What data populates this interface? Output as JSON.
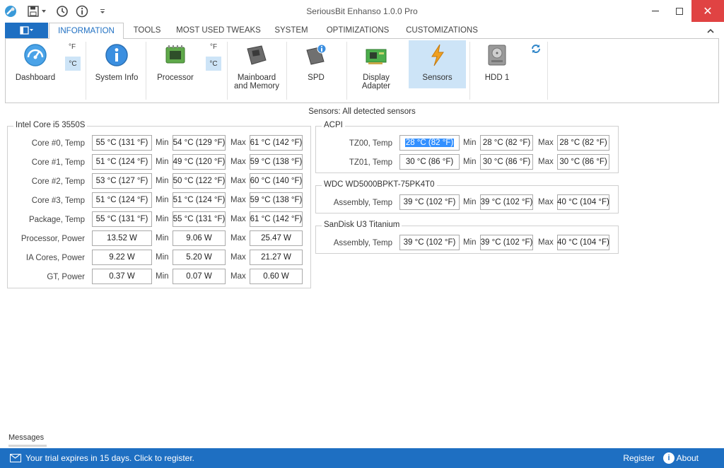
{
  "window": {
    "title": "SeriousBit Enhanso 1.0.0 Pro",
    "close_glyph": "✕"
  },
  "tabs": [
    "INFORMATION",
    "TOOLS",
    "MOST USED TWEAKS",
    "SYSTEM",
    "OPTIMIZATIONS",
    "CUSTOMIZATIONS"
  ],
  "ribbon": {
    "dashboard": "Dashboard",
    "system_info": "System Info",
    "processor": "Processor",
    "mainboard_1": "Mainboard",
    "mainboard_2": "and Memory",
    "spd": "SPD",
    "display_1": "Display",
    "display_2": "Adapter",
    "sensors": "Sensors",
    "hdd": "HDD 1",
    "unit_f": "°F",
    "unit_c": "°C"
  },
  "sensors_title": "Sensors: All detected sensors",
  "labels": {
    "min": "Min",
    "max": "Max"
  },
  "cpu": {
    "title": "Intel Core i5 3550S",
    "rows": [
      {
        "label": "Core #0, Temp",
        "cur": "55 °C (131 °F)",
        "min": "54 °C (129 °F)",
        "max": "61 °C (142 °F)"
      },
      {
        "label": "Core #1, Temp",
        "cur": "51 °C (124 °F)",
        "min": "49 °C (120 °F)",
        "max": "59 °C (138 °F)"
      },
      {
        "label": "Core #2, Temp",
        "cur": "53 °C (127 °F)",
        "min": "50 °C (122 °F)",
        "max": "60 °C (140 °F)"
      },
      {
        "label": "Core #3, Temp",
        "cur": "51 °C (124 °F)",
        "min": "51 °C (124 °F)",
        "max": "59 °C (138 °F)"
      },
      {
        "label": "Package, Temp",
        "cur": "55 °C (131 °F)",
        "min": "55 °C (131 °F)",
        "max": "61 °C (142 °F)"
      },
      {
        "label": "Processor, Power",
        "cur": "13.52 W",
        "min": "9.06 W",
        "max": "25.47 W"
      },
      {
        "label": "IA Cores, Power",
        "cur": "9.22 W",
        "min": "5.20 W",
        "max": "21.27 W"
      },
      {
        "label": "GT, Power",
        "cur": "0.37 W",
        "min": "0.07 W",
        "max": "0.60 W"
      }
    ]
  },
  "acpi": {
    "title": "ACPI",
    "rows": [
      {
        "label": "TZ00, Temp",
        "cur": "28 °C (82 °F)",
        "min": "28 °C (82 °F)",
        "max": "28 °C (82 °F)"
      },
      {
        "label": "TZ01, Temp",
        "cur": "30 °C (86 °F)",
        "min": "30 °C (86 °F)",
        "max": "30 °C (86 °F)"
      }
    ]
  },
  "wdc": {
    "title": "WDC WD5000BPKT-75PK4T0",
    "rows": [
      {
        "label": "Assembly, Temp",
        "cur": "39 °C (102 °F)",
        "min": "39 °C (102 °F)",
        "max": "40 °C (104 °F)"
      }
    ]
  },
  "sandisk": {
    "title": "SanDisk U3 Titanium",
    "rows": [
      {
        "label": "Assembly, Temp",
        "cur": "39 °C (102 °F)",
        "min": "39 °C (102 °F)",
        "max": "40 °C (104 °F)"
      }
    ]
  },
  "messages_tab": "Messages",
  "status": {
    "trial": "Your trial expires in 15 days. Click to register.",
    "register": "Register",
    "about": "About",
    "info_glyph": "i"
  },
  "colors": {
    "accent": "#1e6fc2",
    "close": "#e04343",
    "selected": "#cde4f7",
    "highlight": "#3390ff"
  }
}
